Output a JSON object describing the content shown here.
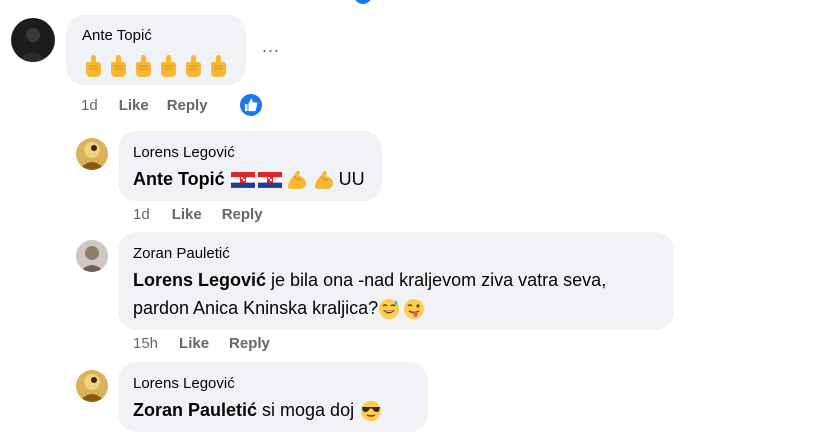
{
  "comments": [
    {
      "author": "Ante Topić",
      "time": "1d",
      "like_label": "Like",
      "reply_label": "Reply",
      "reactions": [
        "like"
      ],
      "body": {
        "emojis": [
          "raised-finger",
          "raised-finger",
          "raised-finger",
          "raised-finger",
          "raised-finger",
          "raised-finger"
        ]
      }
    },
    {
      "author": "Lorens Legović",
      "time": "1d",
      "like_label": "Like",
      "reply_label": "Reply",
      "body": {
        "mention": "Ante Topić",
        "emojis": [
          "croatia-flag",
          "croatia-flag",
          "flexed-biceps",
          "flexed-biceps"
        ],
        "trailing": "UU"
      }
    },
    {
      "author": "Zoran Pauletić",
      "time": "15h",
      "like_label": "Like",
      "reply_label": "Reply",
      "body": {
        "mention": "Lorens Legović",
        "line1": " je bila ona -nad kraljevom ziva vatra seva,",
        "line2": "pardon Anica Kninska kraljica?",
        "emojis": [
          "grinning-sweat",
          "winking-tongue"
        ]
      }
    },
    {
      "author": "Lorens Legović",
      "body": {
        "mention": "Zoran Pauletić",
        "text": " si moga doj",
        "emojis": [
          "sunglasses-face"
        ]
      }
    }
  ],
  "more_label": "...",
  "colors": {
    "bubble": "#f0f2f5",
    "secondary": "#65676b",
    "accent": "#1877f2",
    "text": "#050505"
  }
}
